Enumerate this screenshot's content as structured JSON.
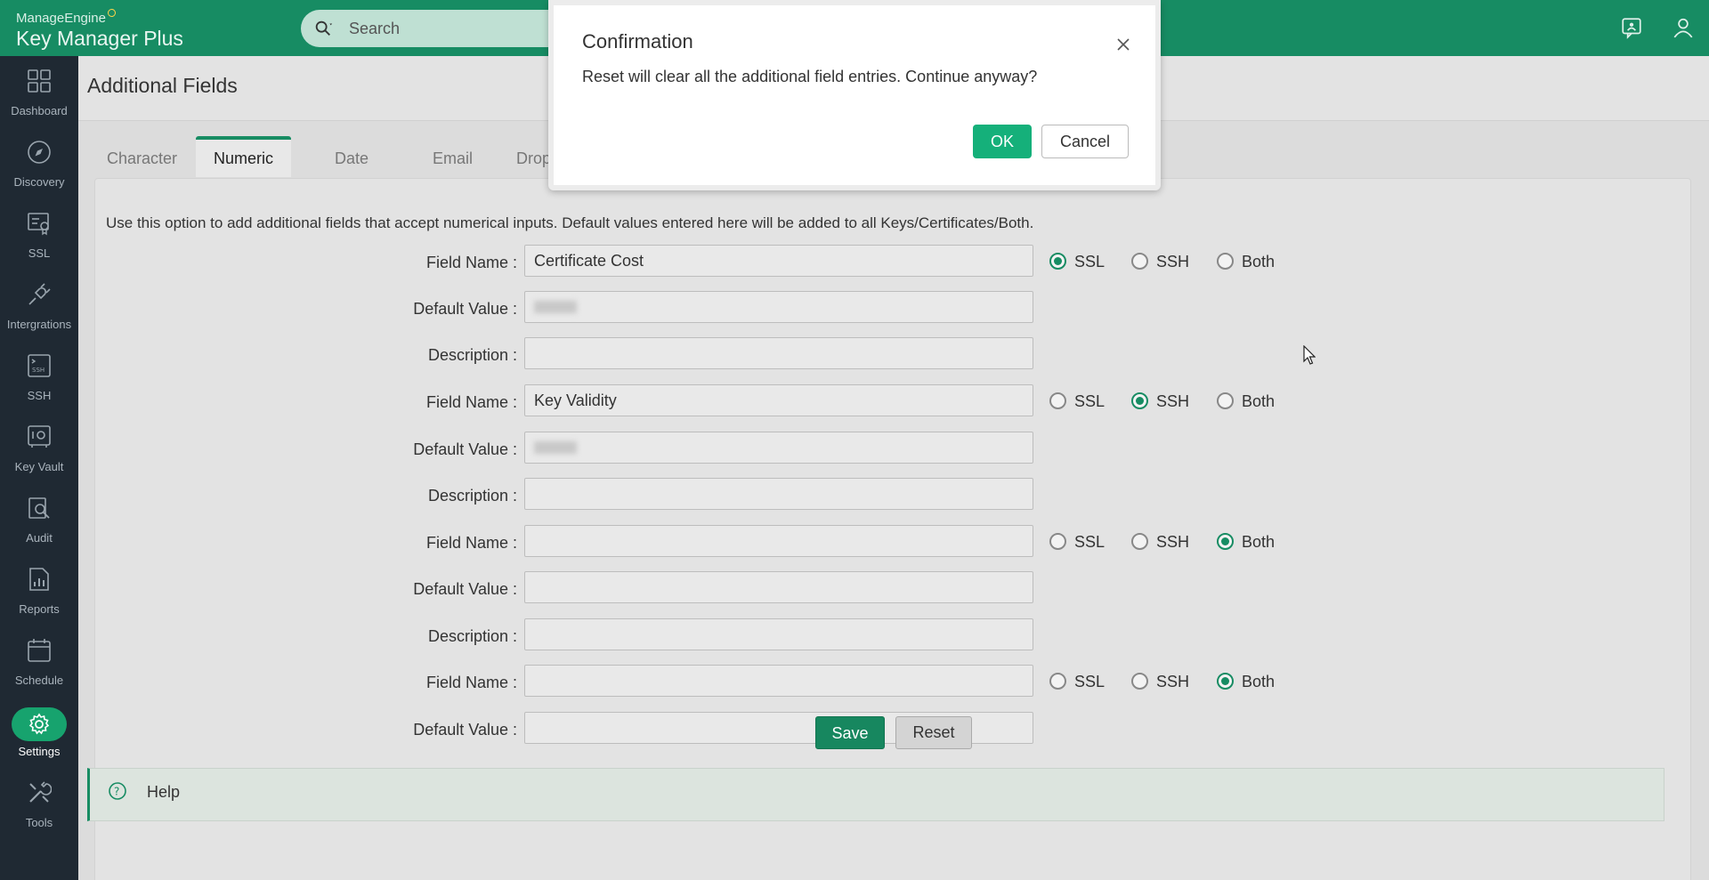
{
  "header": {
    "brand_top": "ManageEngine",
    "brand_main": "Key Manager Plus",
    "search_placeholder": "Search"
  },
  "sidebar": {
    "items": [
      {
        "label": "Dashboard",
        "icon": "dashboard-icon"
      },
      {
        "label": "Discovery",
        "icon": "compass-icon"
      },
      {
        "label": "SSL",
        "icon": "certificate-icon"
      },
      {
        "label": "Intergrations",
        "icon": "plug-icon"
      },
      {
        "label": "SSH",
        "icon": "ssh-terminal-icon"
      },
      {
        "label": "Key Vault",
        "icon": "vault-icon"
      },
      {
        "label": "Audit",
        "icon": "audit-icon"
      },
      {
        "label": "Reports",
        "icon": "reports-icon"
      },
      {
        "label": "Schedule",
        "icon": "calendar-icon"
      },
      {
        "label": "Settings",
        "icon": "gear-icon",
        "active": true
      },
      {
        "label": "Tools",
        "icon": "tools-icon"
      }
    ]
  },
  "page": {
    "title": "Additional Fields",
    "tabs": [
      "Character",
      "Numeric",
      "Date",
      "Email",
      "Dropc"
    ],
    "active_tab": "Numeric",
    "description": "Use this option to add additional fields that accept numerical inputs. Default values entered here will be added to all Keys/Certificates/Both."
  },
  "labels": {
    "field_name": "Field Name :",
    "default_value": "Default Value :",
    "description": "Description :"
  },
  "radio_options": [
    "SSL",
    "SSH",
    "Both"
  ],
  "fields": [
    {
      "name": "Certificate Cost",
      "default_blurred": true,
      "description": "",
      "selected": "SSL"
    },
    {
      "name": "Key Validity",
      "default_blurred": true,
      "description": "",
      "selected": "SSH"
    },
    {
      "name": "",
      "default_blurred": false,
      "description": "",
      "selected": "Both"
    },
    {
      "name": "",
      "default_blurred": false,
      "selected": "Both"
    }
  ],
  "buttons": {
    "save": "Save",
    "reset": "Reset"
  },
  "help": {
    "label": "Help"
  },
  "modal": {
    "title": "Confirmation",
    "message": "Reset will clear all the additional field entries. Continue anyway?",
    "ok": "OK",
    "cancel": "Cancel"
  },
  "colors": {
    "brand_green": "#178c63",
    "sidebar_bg": "#1f2933",
    "ok_button": "#15b07a"
  }
}
